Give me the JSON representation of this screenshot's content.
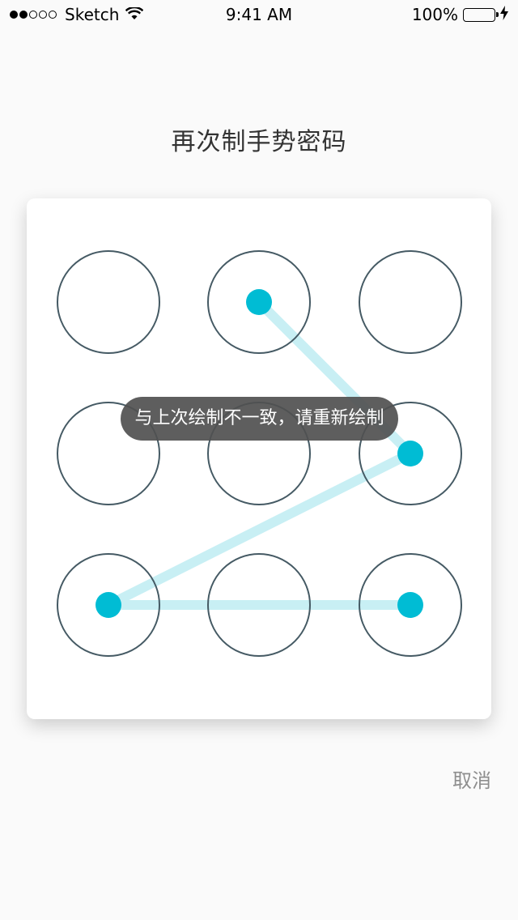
{
  "status_bar": {
    "carrier": "Sketch",
    "time": "9:41 AM",
    "battery": "100%",
    "signal_bars_filled": 2,
    "signal_bars_total": 5
  },
  "title": "再次制手势密码",
  "pattern": {
    "grid": "3x3",
    "selected_nodes": [
      1,
      5,
      6,
      8
    ],
    "path_order": [
      1,
      5,
      6,
      8
    ],
    "colors": {
      "circle_stroke": "#455a64",
      "node_fill": "#00bcd4",
      "line": "#c8eff4"
    }
  },
  "toast": "与上次绘制不一致，请重新绘制",
  "cancel_label": "取消"
}
